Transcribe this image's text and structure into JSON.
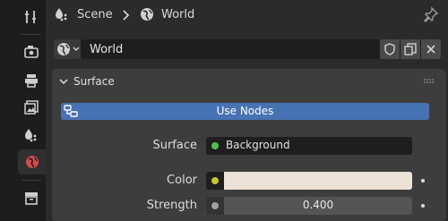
{
  "header": {
    "breadcrumb_scene": "Scene",
    "breadcrumb_world": "World"
  },
  "datablock": {
    "name": "World"
  },
  "panel": {
    "title": "Surface",
    "use_nodes_label": "Use Nodes",
    "surface_label": "Surface",
    "surface_value": "Background",
    "color_label": "Color",
    "color_value": "#ece1d6",
    "strength_label": "Strength",
    "strength_value": "0.400"
  },
  "colors": {
    "accent_blue": "#4772b3",
    "surface_socket": "#4ec04e",
    "color_socket": "#c7c729",
    "float_socket": "#a1a1a1",
    "world_tab": "#dc4d4d"
  }
}
